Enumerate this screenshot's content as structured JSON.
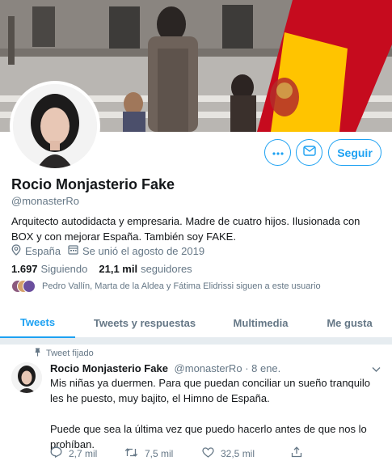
{
  "profile": {
    "name": "Rocio Monjasterio Fake",
    "handle": "@monasterRo",
    "bio": "Arquitecto autodidacta y empresaria. Madre de cuatro hijos. Ilusionada con BOX y con mejorar España. También soy FAKE.",
    "location": "España",
    "joined": "Se unió el agosto de 2019",
    "following_count": "1.697",
    "following_label": "Siguiendo",
    "followers_count": "21,1 mil",
    "followers_label": "seguidores",
    "known_followers": "Pedro Vallín, Marta de la Aldea y Fátima Elidrissi siguen a este usuario"
  },
  "actions": {
    "more_icon": "more-icon",
    "message_icon": "envelope-icon",
    "follow_label": "Seguir"
  },
  "tabs": [
    {
      "label": "Tweets",
      "active": true
    },
    {
      "label": "Tweets y respuestas",
      "active": false
    },
    {
      "label": "Multimedia",
      "active": false
    },
    {
      "label": "Me gusta",
      "active": false
    }
  ],
  "tweet": {
    "pinned_label": "Tweet fijado",
    "author": "Rocio Monjasterio Fake",
    "handle": "@monasterRo",
    "date": "· 8 ene.",
    "text_1": "Mis niñas ya duermen. Para que puedan conciliar un sueño tranquilo les he puesto, muy bajito, el Himno de España.",
    "text_2": "Puede que sea la última vez que puedo hacerlo antes de que nos lo prohíban.",
    "replies": "2,7 mil",
    "retweets": "7,5 mil",
    "likes": "32,5 mil"
  },
  "colors": {
    "accent": "#1da1f2",
    "flag_red": "#c60b1e",
    "flag_yellow": "#ffc400"
  }
}
